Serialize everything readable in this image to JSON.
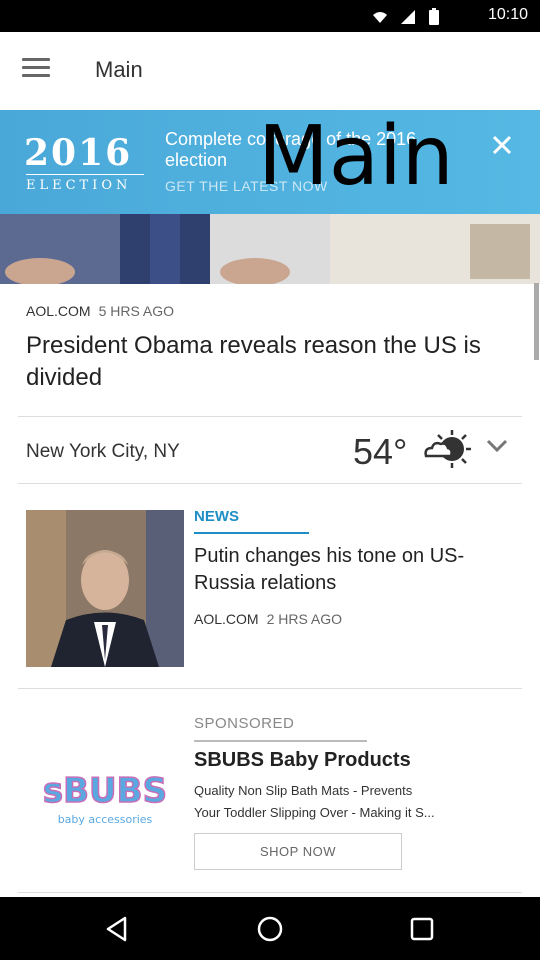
{
  "status_bar": {
    "time": "10:10"
  },
  "app_bar": {
    "title": "Main"
  },
  "banner": {
    "year": "2016",
    "election_word": "ELECTION",
    "headline": "Complete coverage of the 2016 election",
    "cta": "GET THE LATEST NOW",
    "overlay_title": "Main"
  },
  "story1": {
    "source": "AOL.COM",
    "time": "5 HRS AGO",
    "title": "President Obama reveals reason the US is divided"
  },
  "weather": {
    "city": "New York City, NY",
    "temp": "54°"
  },
  "news_card": {
    "label": "NEWS",
    "title": "Putin changes his tone on US-Russia relations",
    "source": "AOL.COM",
    "time": "2 HRS AGO"
  },
  "sponsored": {
    "label": "SPONSORED",
    "brand_logo_text": "sBUBS",
    "brand_logo_sub": "baby accessories",
    "title": "SBUBS Baby Products",
    "desc_line1": "Quality Non Slip Bath Mats - Prevents",
    "desc_line2": "Your Toddler Slipping Over - Making it S...",
    "button": "SHOP NOW"
  },
  "colors": {
    "banner_blue": "#4aa8d8",
    "accent_blue": "#1e8fc6"
  }
}
